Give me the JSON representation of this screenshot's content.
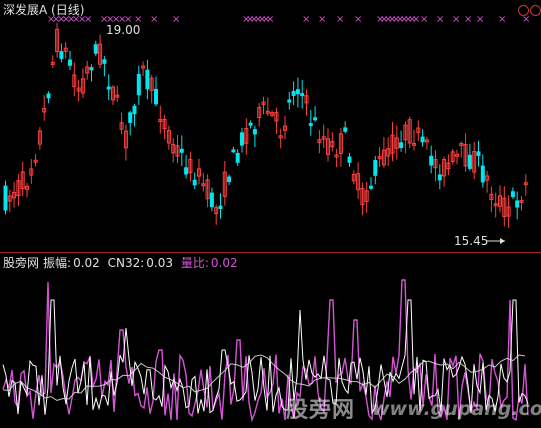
{
  "window": {
    "title": "深发展A",
    "period": "(日线)"
  },
  "price_annotations": {
    "high_label": "19.00",
    "low_label": "15.45"
  },
  "indicator": {
    "source_label": "股旁网",
    "amp_label": "振幅:",
    "amp_value": "0.02",
    "cn_label": "CN32:",
    "cn_value": "0.03",
    "vol_label": "量比:",
    "vol_value": "0.02"
  },
  "watermark": {
    "text": "股旁网",
    "url": "www.gupang.com"
  },
  "colors": {
    "background": "#000000",
    "up": "#ff4040",
    "down": "#00e5ee",
    "signal": "#d455d4",
    "amp_line": "#ffffff",
    "vol_line": "#d455d4",
    "cn_line": "#e8e8e8",
    "label_white": "#e0e0e0",
    "label_magenta": "#d455d4"
  }
}
